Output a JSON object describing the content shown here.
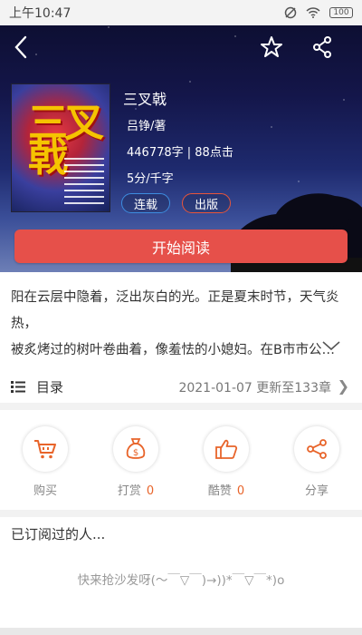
{
  "status": {
    "time": "上午10:47",
    "battery": "100"
  },
  "book": {
    "title": "三叉戟",
    "author": "吕铮/著",
    "stats": "446778字 | 88点击",
    "price": "5分/千字",
    "tags": [
      "连载",
      "出版"
    ],
    "cover_title": "三叉戟",
    "read_button": "开始阅读"
  },
  "description": {
    "lines": [
      "阳在云层中隐着，泛出灰白的光。正是夏末时节，天气炎",
      "热，",
      "被炙烤过的树叶卷曲着，像羞怯的小媳妇。在B市市公…"
    ]
  },
  "toc": {
    "label": "目录",
    "update": "2021-01-07 更新至133章"
  },
  "actions": [
    {
      "label": "购买",
      "count": "",
      "icon": "cart-icon"
    },
    {
      "label": "打赏",
      "count": "0",
      "icon": "money-bag-icon"
    },
    {
      "label": "酷赞",
      "count": "0",
      "icon": "thumbs-up-icon"
    },
    {
      "label": "分享",
      "count": "",
      "icon": "share-icon"
    }
  ],
  "readers": {
    "title": "已订阅过的人...",
    "empty": "快来抢沙发呀(～￣▽￣)→))*￣▽￣*)o"
  },
  "colors": {
    "accent": "#e6504a",
    "icon": "#e8642a",
    "tag_blue": "#3d8de0",
    "tag_red": "#e8553a"
  }
}
